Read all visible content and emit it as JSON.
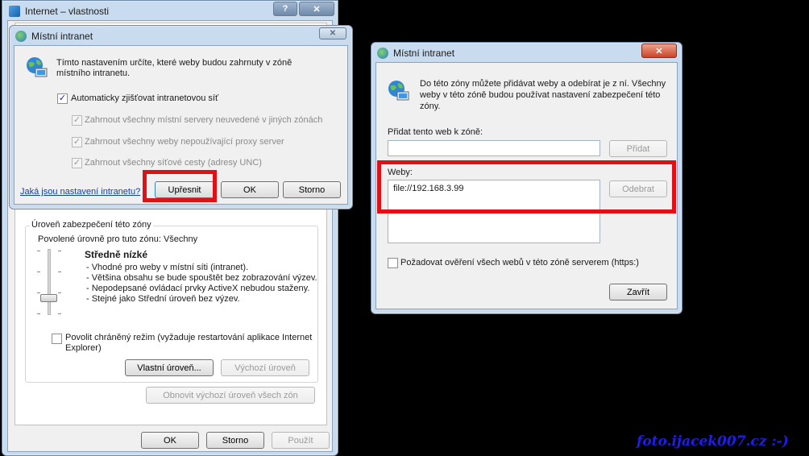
{
  "back_window": {
    "title": "Internet – vlastnosti",
    "help_btn": "?",
    "close_btn": "✕",
    "zone_level_group": "Úroveň zabezpečení této zóny",
    "allowed_levels": "Povolené úrovně pro tuto zónu: Všechny",
    "level_name": "Středně nízké",
    "level_bullets": [
      "- Vhodné pro weby v místní síti (intranet).",
      "- Většina obsahu se bude spouštět bez zobrazování výzev.",
      "- Nepodepsané ovládací prvky ActiveX nebudou staženy.",
      "- Stejné jako Střední úroveň bez výzev."
    ],
    "protected_mode_line1": "Povolit chráněný režim (vyžaduje restartování aplikace Internet",
    "protected_mode_line2": "Explorer)",
    "custom_level_btn": "Vlastní úroveň...",
    "default_level_btn": "Výchozí úroveň",
    "reset_all_btn": "Obnovit výchozí úroveň všech zón",
    "ok_btn": "OK",
    "cancel_btn": "Storno",
    "apply_btn": "Použít"
  },
  "intranet_dialog": {
    "title": "Místní intranet",
    "close_btn": "✕",
    "description_line1": "Tímto nastavením určíte, které weby budou zahrnuty v zóně",
    "description_line2": "místního intranetu.",
    "auto_detect": "Automaticky zjišťovat intranetovou síť",
    "auto_detect_checked": true,
    "include_local": "Zahrnout všechny místní servery neuvedené v jiných zónách",
    "include_no_proxy": "Zahrnout všechny weby nepoužívající proxy server",
    "include_unc": "Zahrnout všechny síťové cesty (adresy UNC)",
    "help_link": "Jaká jsou nastavení intranetu?",
    "advanced_btn": "Upřesnit",
    "ok_btn": "OK",
    "cancel_btn": "Storno"
  },
  "sites_dialog": {
    "title": "Místní intranet",
    "close_btn": "✕",
    "description_line1": "Do této zóny můžete přidávat weby a odebírat je z ní. Všechny",
    "description_line2": "weby v této zóně budou používat nastavení zabezpečení této",
    "description_line3": "zóny.",
    "add_label": "Přidat tento web k zóně:",
    "add_input_value": "",
    "add_btn": "Přidat",
    "websites_label": "Weby:",
    "websites": [
      "file://192.168.3.99"
    ],
    "remove_btn": "Odebrat",
    "require_https": "Požadovat ověření všech webů v této zóně serverem (https:)",
    "close_dialog_btn": "Zavřít"
  },
  "watermark": "foto.ijacek007.cz :-)",
  "colors": {
    "highlight_red": "#e01016",
    "watermark": "#1d1df0",
    "link": "#0b3fbf"
  }
}
